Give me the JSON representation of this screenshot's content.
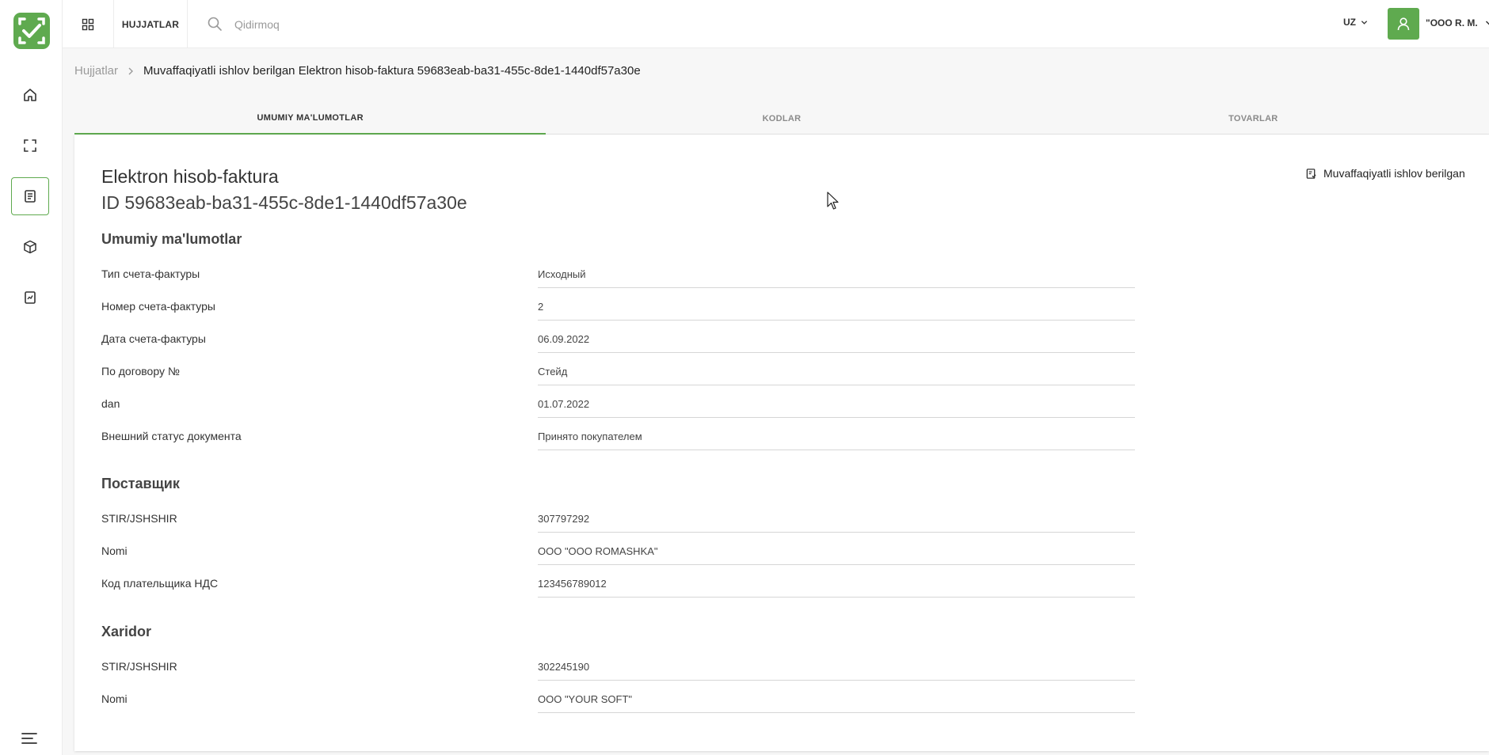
{
  "topbar": {
    "docs_tab": "HUJJATLAR",
    "search_placeholder": "Qidirmoq",
    "lang": "UZ",
    "username": "\"OOO R. M."
  },
  "breadcrumb": {
    "root": "Hujjatlar",
    "current": "Muvaffaqiyatli ishlov berilgan Elektron hisob-faktura 59683eab-ba31-455c-8de1-1440df57a30e"
  },
  "tabs": [
    {
      "label": "UMUMIY MA'LUMOTLAR"
    },
    {
      "label": "KODLAR"
    },
    {
      "label": "TOVARLAR"
    }
  ],
  "document": {
    "title": "Elektron hisob-faktura",
    "id": "ID 59683eab-ba31-455c-8de1-1440df57a30e",
    "status": "Muvaffaqiyatli ishlov berilgan"
  },
  "sections": {
    "general": {
      "title": "Umumiy ma'lumotlar",
      "rows": [
        {
          "label": "Тип счета-фактуры",
          "value": "Исходный"
        },
        {
          "label": "Номер счета-фактуры",
          "value": "2"
        },
        {
          "label": "Дата счета-фактуры",
          "value": "06.09.2022"
        },
        {
          "label": "По договору №",
          "value": "Стейд"
        },
        {
          "label": "dan",
          "value": "01.07.2022"
        },
        {
          "label": "Внешний статус документа",
          "value": "Принято покупателем"
        }
      ]
    },
    "supplier": {
      "title": "Поставщик",
      "rows": [
        {
          "label": "STIR/JSHSHIR",
          "value": "307797292"
        },
        {
          "label": "Nomi",
          "value": "ООО \"OOO ROMASHKA\""
        },
        {
          "label": "Код плательщика НДС",
          "value": "123456789012"
        }
      ]
    },
    "buyer": {
      "title": "Xaridor",
      "rows": [
        {
          "label": "STIR/JSHSHIR",
          "value": "302245190"
        },
        {
          "label": "Nomi",
          "value": "ООО \"YOUR SOFT\""
        }
      ]
    }
  },
  "colors": {
    "accent": "#5faa4f"
  }
}
